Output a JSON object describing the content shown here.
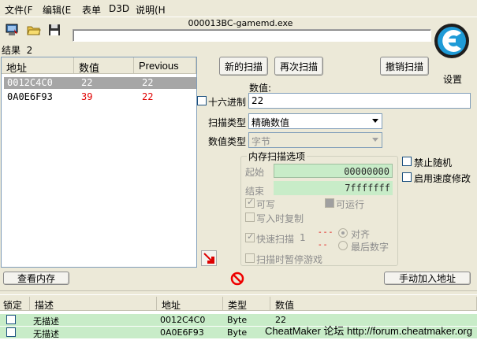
{
  "menu": [
    "文件(F",
    "编辑(E",
    "表单",
    "D3D",
    "说明(H"
  ],
  "window_title": "000013BC-gamemd.exe",
  "results_label": "结果",
  "results_count": "2",
  "list": {
    "headers": [
      "地址",
      "数值",
      "Previous"
    ],
    "rows": [
      {
        "address": "0012C4C0",
        "value": "22",
        "previous": "22"
      },
      {
        "address": "0A0E6F93",
        "value": "39",
        "previous": "22"
      }
    ]
  },
  "buttons": {
    "new_scan": "新的扫描",
    "next_scan": "再次扫描",
    "undo_scan": "撤销扫描",
    "view_memory": "查看内存",
    "add_address": "手动加入地址"
  },
  "logo": {
    "settings": "设置",
    "accent": "#1f9bd7"
  },
  "value_label": "数值:",
  "hex_label": "十六进制",
  "value_input": "22",
  "scan_type_label": "扫描类型",
  "scan_type_value": "精确数值",
  "value_type_label": "数值类型",
  "value_type_value": "字节",
  "memory_options": {
    "title": "内存扫描选项",
    "start_label": "起始",
    "start_value": "00000000",
    "end_label": "结束",
    "end_value": "7fffffff",
    "writable": "可写",
    "executable": "可运行",
    "copy_on_write": "写入时复制",
    "fast_scan": "快速扫描",
    "fast_scan_value": "1",
    "aligned": "对齐",
    "last_digits": "最后数字",
    "pause_game": "扫描时暂停游戏"
  },
  "disable_random": "禁止随机",
  "enable_speedhack": "启用速度修改",
  "bottom_table": {
    "headers": [
      "锁定",
      "描述",
      "地址",
      "类型",
      "数值"
    ],
    "rows": [
      {
        "description": "无描述",
        "address": "0012C4C0",
        "type": "Byte",
        "value": "22"
      },
      {
        "description": "无描述",
        "address": "0A0E6F93",
        "type": "Byte",
        "value": "22"
      }
    ]
  },
  "watermark": "CheatMaker 论坛 http://forum.cheatmaker.org",
  "colors": {
    "selected_row": "#a6a6a6",
    "changed_value": "#e00000",
    "green_row": "#c8ecc8"
  }
}
